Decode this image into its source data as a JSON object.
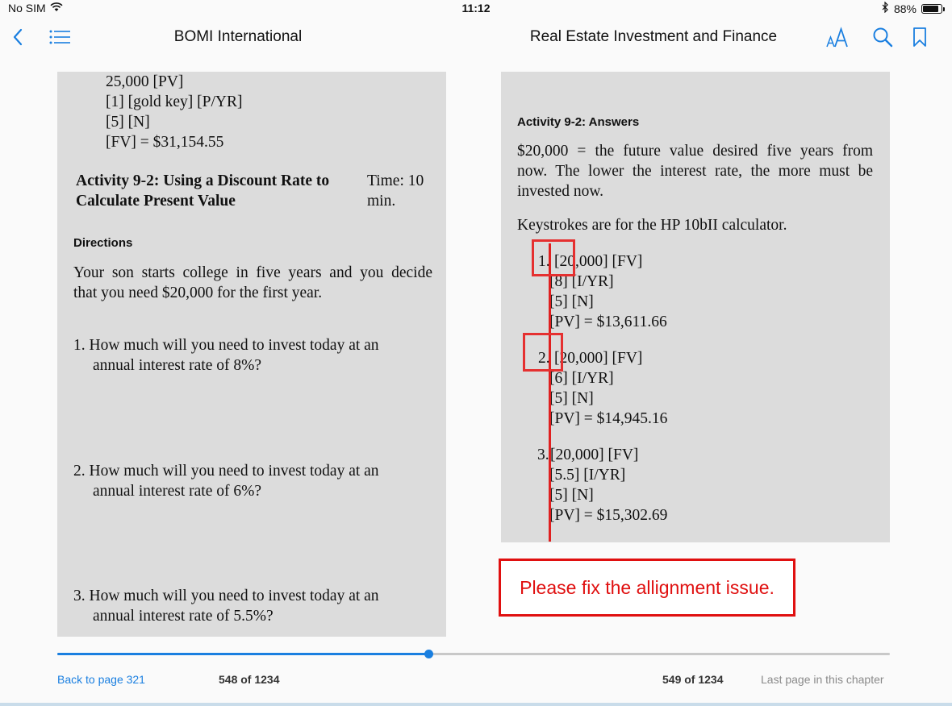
{
  "status": {
    "carrier": "No SIM",
    "time": "11:12",
    "battery": "88%",
    "battery_level": 0.88
  },
  "nav": {
    "left_title": "BOMI International",
    "right_title": "Real Estate Investment and Finance",
    "icons": [
      "back-chevron-icon",
      "table-of-contents-icon",
      "font-size-icon",
      "search-icon",
      "bookmark-icon"
    ],
    "accent_color": "#1a7fe0"
  },
  "left_page": {
    "keystrokes": [
      "25,000 [PV]",
      "[1] [gold key] [P/YR]",
      "[5] [N]",
      "[FV] = $31,154.55"
    ],
    "activity_title_line1": "Activity 9-2: Using a Discount Rate to",
    "activity_title_line2": "Calculate Present Value",
    "time_line1": "Time: 10",
    "time_line2": "min.",
    "directions_heading": "Directions",
    "directions_line1": "Your son starts college in five years and you decide",
    "directions_line2": "that you need $20,000 for the first year.",
    "questions": [
      {
        "line1": "1. How much will you need to invest today at an",
        "line2": "annual interest rate of 8%?"
      },
      {
        "line1": "2. How much will you need to invest today at an",
        "line2": "annual interest rate of 6%?"
      },
      {
        "line1": "3. How much will you need to invest today at an",
        "line2": "annual interest rate of 5.5%?"
      }
    ]
  },
  "right_page": {
    "heading": "Activity 9-2: Answers",
    "intro_line1": "$20,000 = the future value desired five years from",
    "intro_line2": "now. The lower the interest rate, the more must be",
    "intro_line3": "invested now.",
    "keystroke_note": "Keystrokes are for the HP 10bII calculator.",
    "answers": [
      {
        "num": "1.",
        "lines": [
          "[20,000] [FV]",
          "[8] [I/YR]",
          "[5] [N]",
          "[PV] = $13,611.66"
        ]
      },
      {
        "num": "2.",
        "lines": [
          "[20,000] [FV]",
          "[6] [I/YR]",
          "[5] [N]",
          "[PV] = $14,945.16"
        ]
      },
      {
        "num": "3.",
        "lines": [
          "[20,000] [FV]",
          "[5.5] [I/YR]",
          "[5] [N]",
          "[PV] = $15,302.69"
        ]
      }
    ]
  },
  "annotation": {
    "comment": "Please fix the allignment issue.",
    "color": "#e01010"
  },
  "footer": {
    "back_link": "Back to page 321",
    "left_page_number": "548 of 1234",
    "right_page_number": "549 of 1234",
    "chapter_note": "Last page in this chapter",
    "progress": 0.446
  }
}
